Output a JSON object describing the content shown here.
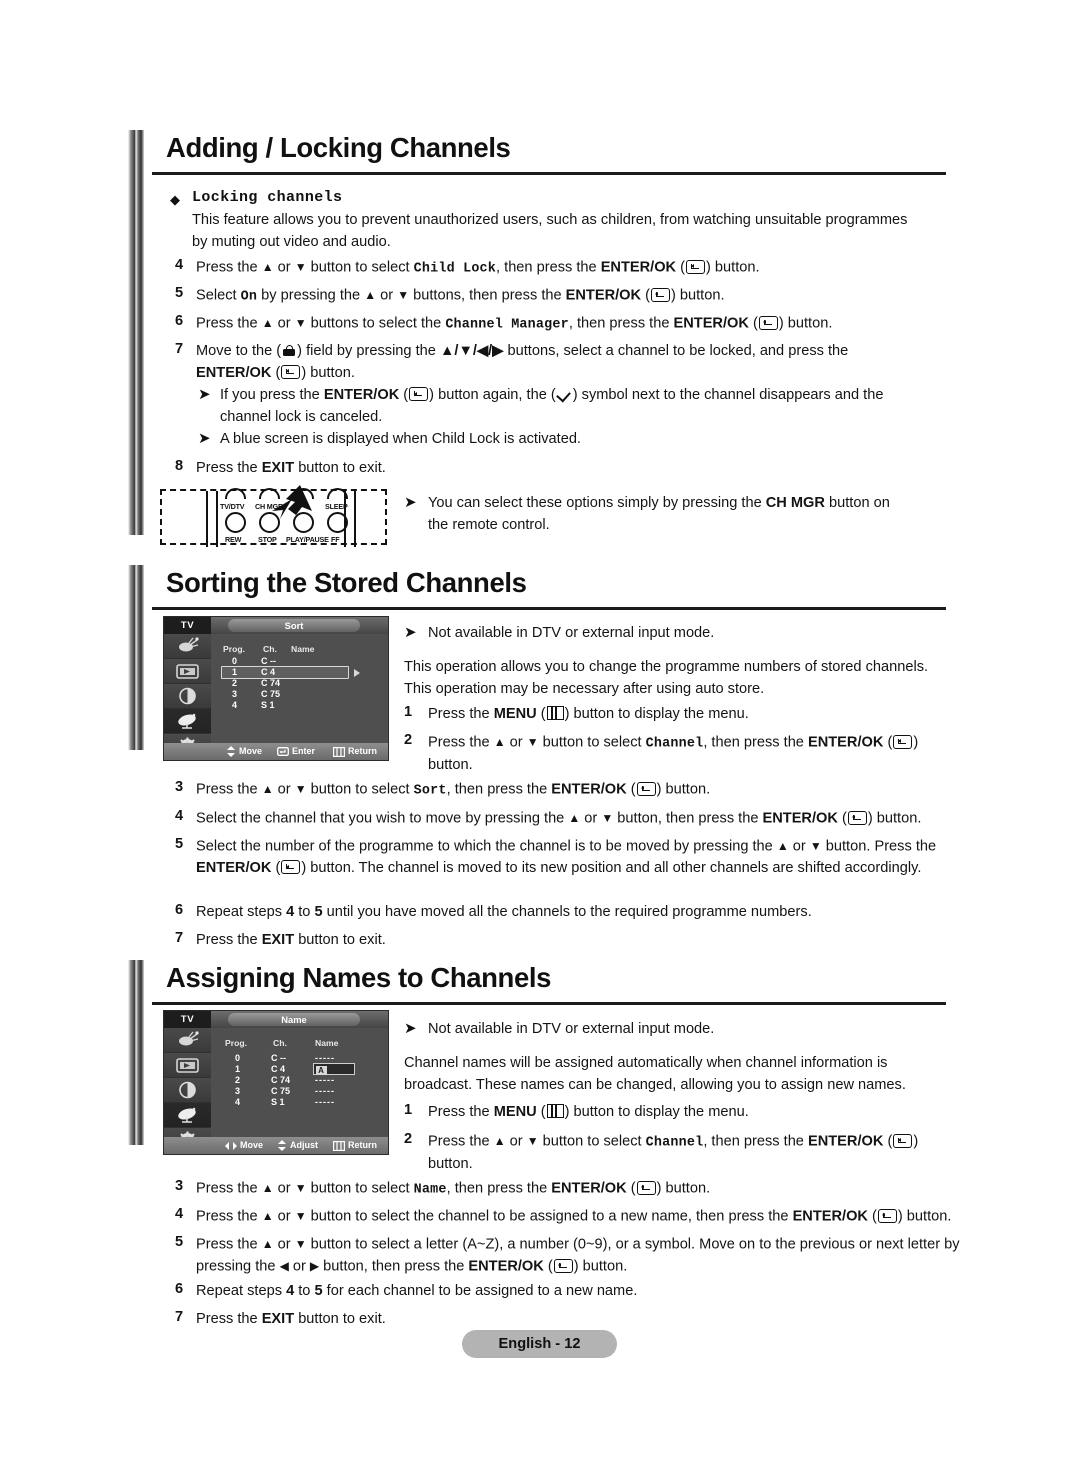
{
  "page": {
    "footer_label": "English - 12"
  },
  "sections": [
    {
      "title": "Adding / Locking Channels",
      "subhead": "Locking channels",
      "intro": "This feature allows you to prevent unauthorized users, such as children, from watching unsuitable programmes by muting out video and audio.",
      "steps": [
        {
          "num": "4",
          "text_1": "Press the ",
          "text_code": "Child Lock",
          "text_2": ", then press the "
        },
        {
          "num": "5",
          "text": "Select On by pressing the or buttons, then press the ENTER/OK button."
        },
        {
          "num": "6",
          "text": "Press the or buttons to select the Channel Manager, then press the ENTER/OK button."
        },
        {
          "num": "7",
          "text": "Move to the field by pressing the buttons, select a channel to be locked, and press the ENTER/OK button."
        },
        {
          "num": "8",
          "text": "Press the EXIT button to exit."
        }
      ],
      "notes": [
        "If you press the ENTER/OK ( ) button again, the ( ) symbol next to the channel disappears and the channel lock is canceled.",
        "A blue screen is displayed when Child Lock is activated.",
        "You can select these options simply by pressing the CH MGR button on the remote control."
      ]
    },
    {
      "title": "Sorting the Stored Channels",
      "note": "Not available in DTV or external input mode.",
      "intro": "This operation allows you to change the programme numbers of stored channels. This operation may be necessary after using auto store."
    },
    {
      "title": "Assigning Names to Channels",
      "note": "Not available in DTV or external input mode.",
      "intro": "Channel names will be assigned automatically when channel information is broadcast. These names can be changed, allowing you to assign new names."
    }
  ],
  "locking": {
    "step4_a": "Press the ",
    "step4_code": "Child Lock",
    "step4_b": ", then press the ",
    "step5_a": "Select ",
    "step5_code": "On",
    "step5_b": " by pressing the ",
    "step6_code": "Channel Manager"
  },
  "remote": {
    "top_labels": [
      "TV/DTV",
      "CH MGR",
      "SLEEP"
    ],
    "bottom_labels": [
      "REW",
      "STOP",
      "PLAY/PAUSE",
      "FF"
    ],
    "highlight_button": "CH MGR"
  },
  "osd_sort": {
    "tv_label": "TV",
    "title": "Sort",
    "headers": [
      "Prog.",
      "Ch.",
      "Name"
    ],
    "rows": [
      {
        "prog": "0",
        "ch": "C --",
        "name": ""
      },
      {
        "prog": "1",
        "ch": "C 4",
        "name": ""
      },
      {
        "prog": "2",
        "ch": "C 74",
        "name": ""
      },
      {
        "prog": "3",
        "ch": "C 75",
        "name": ""
      },
      {
        "prog": "4",
        "ch": "S 1",
        "name": ""
      }
    ],
    "selected_row_index": 1,
    "footer": [
      {
        "icon": "updown-icon",
        "label": "Move"
      },
      {
        "icon": "enter-icon",
        "label": "Enter"
      },
      {
        "icon": "menu-icon",
        "label": "Return"
      }
    ],
    "sidebar_icons": [
      "input-icon",
      "picture-icon",
      "sound-icon",
      "channel-dish-icon",
      "setup-gear-icon"
    ],
    "sidebar_selected_index": 3
  },
  "osd_name": {
    "tv_label": "TV",
    "title": "Name",
    "headers": [
      "Prog.",
      "Ch.",
      "Name"
    ],
    "rows": [
      {
        "prog": "0",
        "ch": "C --",
        "name": "-----"
      },
      {
        "prog": "1",
        "ch": "C 4",
        "name": "",
        "edit_char": "A"
      },
      {
        "prog": "2",
        "ch": "C 74",
        "name": "-----"
      },
      {
        "prog": "3",
        "ch": "C 75",
        "name": "-----"
      },
      {
        "prog": "4",
        "ch": "S 1",
        "name": "-----"
      }
    ],
    "selected_row_index": 1,
    "footer": [
      {
        "icon": "leftright-icon",
        "label": "Move"
      },
      {
        "icon": "updown-icon",
        "label": "Adjust"
      },
      {
        "icon": "menu-icon",
        "label": "Return"
      }
    ],
    "sidebar_icons": [
      "input-icon",
      "picture-icon",
      "sound-icon",
      "channel-dish-icon",
      "setup-gear-icon"
    ],
    "sidebar_selected_index": 3
  },
  "sort_steps": [
    {
      "num": "1",
      "text": "Press the MENU ( ) button to display the menu."
    },
    {
      "num": "2",
      "text": "Press the or button to select Channel, then press the ENTER/OK ( ) button."
    },
    {
      "num": "3",
      "text": "Press the or button to select Sort, then press the ENTER/OK ( ) button."
    },
    {
      "num": "4",
      "text": "Select the channel that you wish to move by pressing the or button, then press the ENTER/OK ( ) button."
    },
    {
      "num": "5",
      "text": "Select the number of the programme to which the channel is to be moved by pressing the or button. Press the ENTER/OK ( ) button. The channel is moved to its new position and all other channels are shifted accordingly."
    },
    {
      "num": "6",
      "text": "Repeat steps 4 to 5 until you have moved all the channels to the required programme numbers."
    },
    {
      "num": "7",
      "text": "Press the EXIT button to exit."
    }
  ],
  "name_steps": [
    {
      "num": "1",
      "text": "Press the MENU ( ) button to display the menu."
    },
    {
      "num": "2",
      "text": "Press the or button to select Channel, then press the ENTER/OK ( ) button."
    },
    {
      "num": "3",
      "text": "Press the or button to select Name, then press the ENTER/OK ( ) button."
    },
    {
      "num": "4",
      "text": "Press the or button to select the channel to be assigned to a new name, then press the ENTER/OK ( ) button."
    },
    {
      "num": "5",
      "text": "Press the or button to select a letter (A~Z), a number (0~9), or a symbol. Move on to the previous or next letter by pressing the or button, then press the ENTER/OK ( ) button."
    },
    {
      "num": "6",
      "text": "Repeat steps 4 to 5 for each channel to be assigned to a new name."
    },
    {
      "num": "7",
      "text": "Press the EXIT button to exit."
    }
  ],
  "labels": {
    "enter_ok": "ENTER/OK",
    "menu": "MENU",
    "exit": "EXIT",
    "ch_mgr": "CH MGR",
    "channel": "Channel",
    "sort": "Sort",
    "name": "Name",
    "on": "On",
    "child_lock": "Child Lock",
    "channel_manager": "Channel Manager"
  },
  "colors": {
    "text": "#141414",
    "rule": "#1c1c1c",
    "badge_bg": "#b3b3b3",
    "osd_bg": "#4f4f4f"
  }
}
